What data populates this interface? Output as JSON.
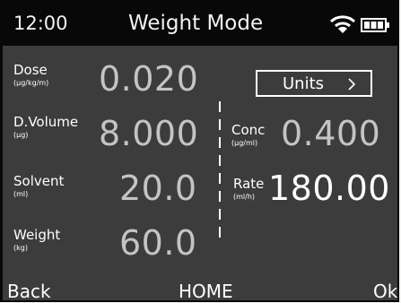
{
  "status_bar": {
    "time": "12:00",
    "title": "Weight Mode",
    "wifi_icon": "wifi-icon",
    "battery_icon": "battery-icon"
  },
  "fields": {
    "dose": {
      "label": "Dose",
      "unit": "(µg/kg/m)",
      "value": "0.020"
    },
    "dvolume": {
      "label": "D.Volume",
      "unit": "(µg)",
      "value": "8.000"
    },
    "solvent": {
      "label": "Solvent",
      "unit": "(ml)",
      "value": "20.0"
    },
    "weight": {
      "label": "Weight",
      "unit": "(kg)",
      "value": "60.0"
    },
    "conc": {
      "label": "Conc",
      "unit": "(µg/ml)",
      "value": "0.400"
    },
    "rate": {
      "label": "Rate",
      "unit": "(ml/h)",
      "value": "180.00"
    }
  },
  "units_button": {
    "label": "Units",
    "icon": "chevron-right-icon"
  },
  "softkeys": {
    "left": "Back",
    "center": "HOME",
    "right": "Ok"
  },
  "colors": {
    "background": "#3c3c3c",
    "status_bar": "#080808",
    "value_dim": "#c4c4c4",
    "value_bright": "#ffffff",
    "text": "#ffffff"
  }
}
